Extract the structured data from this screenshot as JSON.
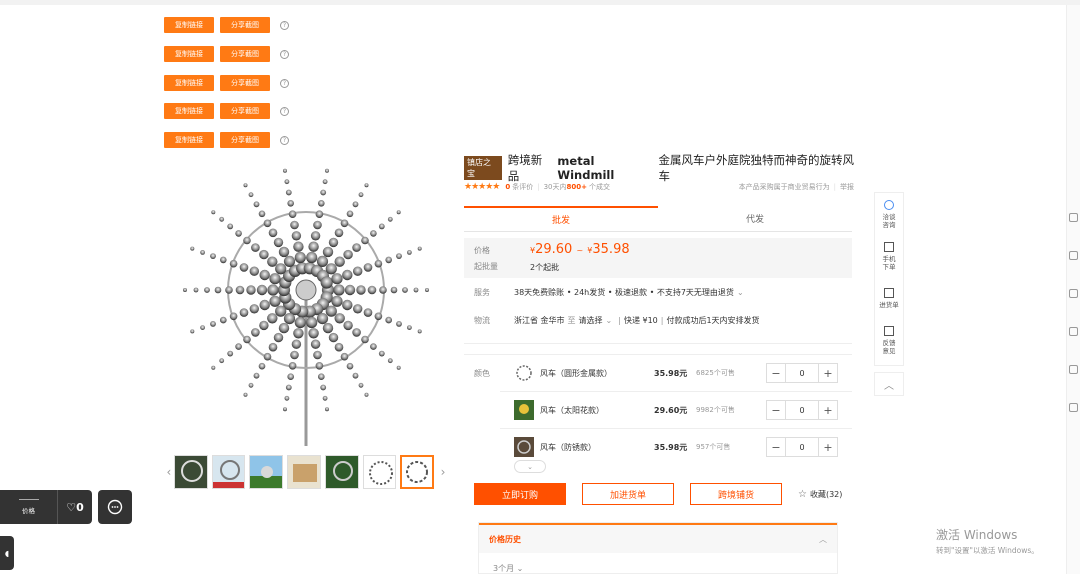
{
  "share_rows": [
    {
      "copy": "复制链接",
      "share": "分享截图",
      "help": "?"
    },
    {
      "copy": "复制链接",
      "share": "分享截图",
      "help": "?"
    },
    {
      "copy": "复制链接",
      "share": "分享截图",
      "help": "?"
    },
    {
      "copy": "复制链接",
      "share": "分享截图",
      "help": "?"
    },
    {
      "copy": "复制链接",
      "share": "分享截图",
      "help": "?"
    }
  ],
  "product": {
    "badge": "镇店之宝",
    "title_pre": "跨境新品",
    "title_bold": "metal Windmill",
    "title_post": "金属风车户外庭院独特而神奇的旋转风车",
    "stars": "★★★★★",
    "review_count": "0",
    "review_label": "条评价",
    "sales_prefix": "30天内",
    "sales_count": "800+",
    "sales_suffix": "个成交",
    "compliance": "本产品采购属于商业贸易行为",
    "report": "举报"
  },
  "tabs": [
    "批发",
    "代发"
  ],
  "pricing": {
    "price_label": "价格",
    "currency": "¥",
    "price_low": "29.60",
    "tilde": "~",
    "price_high": "35.98",
    "moq_label": "起批量",
    "moq": "2个起批"
  },
  "service": {
    "label": "服务",
    "text": "38天免费赊账 • 24h发货 • 极速退款 • 不支持7天无理由退货",
    "chevron": "⌄"
  },
  "logistics": {
    "label": "物流",
    "from": "浙江省 金华市",
    "to_label": "至",
    "to": "请选择",
    "chevron": "⌄",
    "shipping": "快递 ¥10",
    "note": "付款成功后1天内安排发货"
  },
  "color_label": "颜色",
  "skus": [
    {
      "name": "风车（圆形金属款）",
      "price": "35.98元",
      "stock": "6825个可售",
      "qty": "0"
    },
    {
      "name": "风车（太阳花款）",
      "price": "29.60元",
      "stock": "9982个可售",
      "qty": "0"
    },
    {
      "name": "风车（防锈款）",
      "price": "35.98元",
      "stock": "957个可售",
      "qty": "0"
    }
  ],
  "stepper": {
    "minus": "−",
    "plus": "+"
  },
  "actions": {
    "buy": "立即订购",
    "cart": "加进货单",
    "crossborder": "跨境铺货",
    "fav_icon": "☆",
    "fav": "收藏(32)"
  },
  "history": {
    "title": "价格历史",
    "caret": "︿",
    "period": "3个月 ⌄"
  },
  "side_panel": [
    {
      "label1": "洽谈",
      "label2": "咨询",
      "icon": "chat-icon"
    },
    {
      "label1": "手机",
      "label2": "下单",
      "icon": "qrcode-icon"
    },
    {
      "label1": "进货单",
      "label2": "",
      "icon": "clipboard-icon"
    },
    {
      "label1": "反馈",
      "label2": "意见",
      "icon": "edit-icon"
    }
  ],
  "to_top": "︿",
  "float_bar": {
    "price_label": "价格",
    "heart": "♡",
    "fav_count": "0"
  },
  "watermark": {
    "line1": "激活 Windows",
    "line2": "转到\"设置\"以激活 Windows。"
  },
  "colors": {
    "orange": "#ff7a14",
    "red_orange": "#ff5000",
    "badge": "#7c4a1e"
  }
}
